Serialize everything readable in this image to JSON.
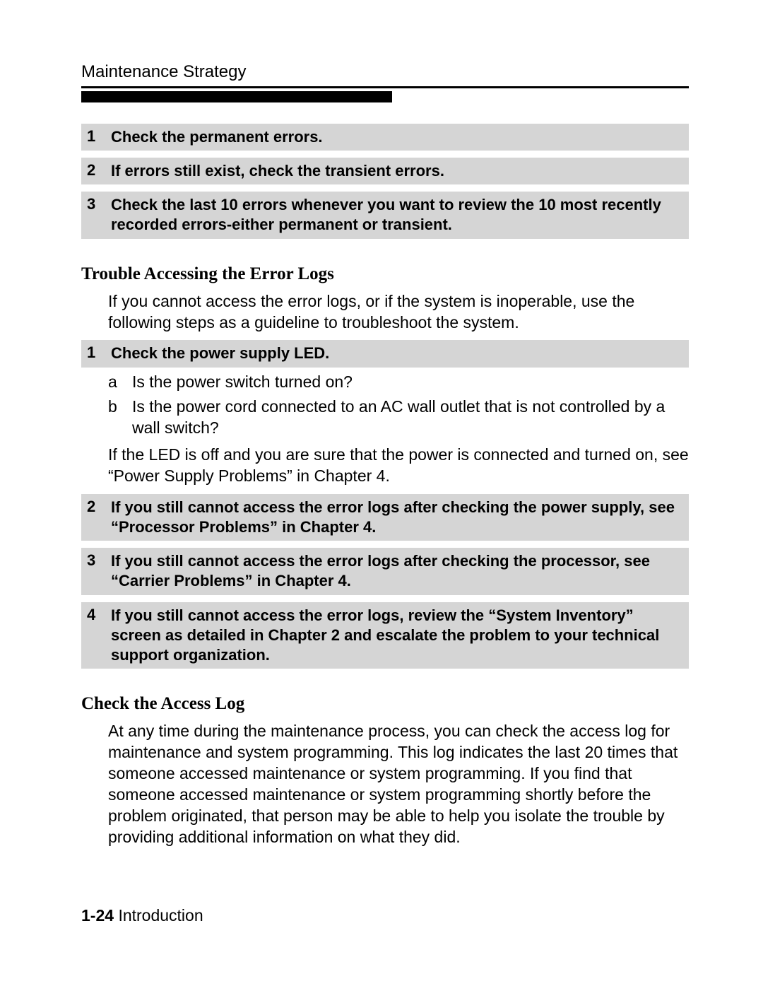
{
  "header": {
    "title": "Maintenance Strategy"
  },
  "topSteps": [
    {
      "num": "1",
      "text": "Check the permanent errors."
    },
    {
      "num": "2",
      "text": "If errors still exist, check the transient errors."
    },
    {
      "num": "3",
      "text": "Check the last 10 errors whenever you want to review the 10 most recently recorded errors-either permanent or transient."
    }
  ],
  "section1": {
    "heading": "Trouble Accessing the Error Logs",
    "intro": "If you cannot access the error logs, or if the system is inoperable, use the following steps as a guideline to troubleshoot the system.",
    "steps": [
      {
        "num": "1",
        "text": "Check the power supply LED."
      }
    ],
    "sub": [
      {
        "letter": "a",
        "text": "Is the power switch turned on?"
      },
      {
        "letter": "b",
        "text": "Is the power cord connected to an AC wall outlet that is not controlled by a wall switch?"
      }
    ],
    "afterSub": "If the LED is off and you are sure that the power is connected and turned on, see “Power Supply Problems” in Chapter 4.",
    "steps2": [
      {
        "num": "2",
        "text": "If you still cannot access the error logs after checking the power supply, see “Processor Problems” in Chapter 4."
      },
      {
        "num": "3",
        "text": "If you still cannot access the error logs after checking the processor, see “Carrier Problems” in Chapter 4."
      },
      {
        "num": "4",
        "text": "If you still cannot access the error logs, review the “System Inventory” screen as detailed in Chapter 2 and escalate the problem to your technical support organization."
      }
    ]
  },
  "section2": {
    "heading": "Check the Access Log",
    "para": "At any time during the maintenance process, you can check the access log for maintenance and system programming. This log indicates the last 20 times that someone accessed maintenance or system programming. If you find that someone accessed maintenance or system programming shortly before the problem originated, that person may be able to help you isolate the trouble by providing additional information on what they did."
  },
  "footer": {
    "page": "1-24",
    "label": "Introduction"
  }
}
